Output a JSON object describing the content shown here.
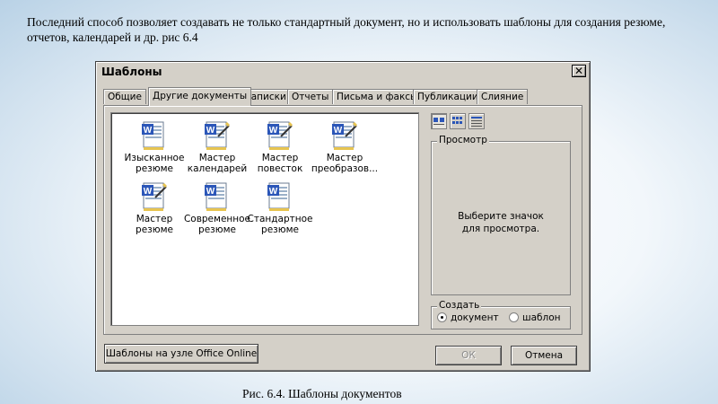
{
  "intro_text": "Последний способ позволяет создавать не только стандартный документ, но и использовать шаблоны для создания резюме, отчетов, календарей и др. рис 6.4",
  "caption": "Рис. 6.4. Шаблоны документов",
  "dialog": {
    "title": "Шаблоны",
    "close_label": "✕",
    "tabs": [
      {
        "label": "Общие"
      },
      {
        "label": "Другие документы"
      },
      {
        "label": "Записки"
      },
      {
        "label": "Отчеты"
      },
      {
        "label": "Письма и факсы"
      },
      {
        "label": "Публикации"
      },
      {
        "label": "Слияние"
      }
    ],
    "active_tab": "Другие документы",
    "templates": [
      {
        "line1": "Изысканное",
        "line2": "резюме",
        "icon": "word-template-icon"
      },
      {
        "line1": "Мастер",
        "line2": "календарей",
        "icon": "word-wizard-icon"
      },
      {
        "line1": "Мастер",
        "line2": "повесток",
        "icon": "word-wizard-icon"
      },
      {
        "line1": "Мастер",
        "line2": "преобразов...",
        "icon": "word-wizard-icon"
      },
      {
        "line1": "Мастер",
        "line2": "резюме",
        "icon": "word-wizard-icon"
      },
      {
        "line1": "Современное",
        "line2": "резюме",
        "icon": "word-template-icon"
      },
      {
        "line1": "Стандартное",
        "line2": "резюме",
        "icon": "word-template-icon"
      }
    ],
    "view_buttons": [
      "large-icons-view-icon",
      "list-view-icon",
      "details-view-icon"
    ],
    "preview": {
      "title": "Просмотр",
      "line1": "Выберите значок",
      "line2": "для просмотра."
    },
    "create": {
      "title": "Создать",
      "options": [
        {
          "label": "документ",
          "checked": true
        },
        {
          "label": "шаблон",
          "checked": false
        }
      ]
    },
    "buttons": {
      "online": "Шаблоны на узле Office Online",
      "ok": "ОК",
      "cancel": "Отмена"
    }
  }
}
